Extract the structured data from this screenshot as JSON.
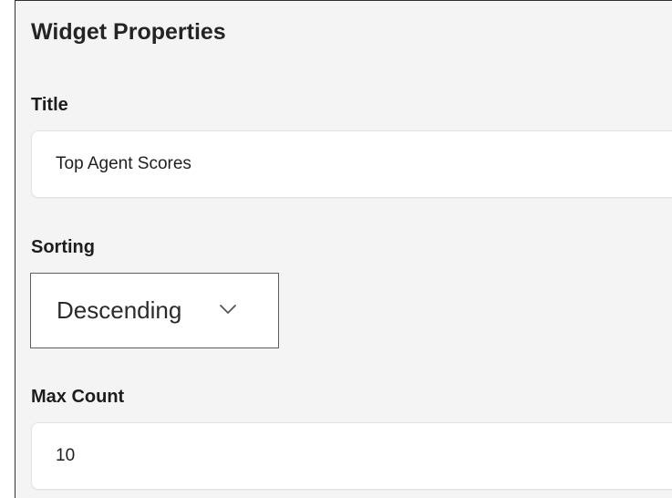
{
  "panel": {
    "title": "Widget Properties"
  },
  "fields": {
    "title": {
      "label": "Title",
      "value": "Top Agent Scores"
    },
    "sorting": {
      "label": "Sorting",
      "selected": "Descending",
      "icon": "chevron-down-icon"
    },
    "max_count": {
      "label": "Max Count",
      "value": "10"
    }
  }
}
